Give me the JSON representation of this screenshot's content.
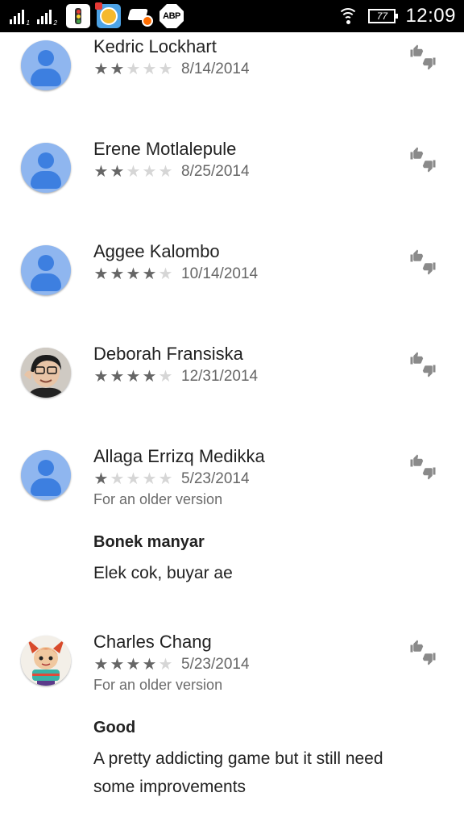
{
  "status_bar": {
    "sim1_label": "1",
    "sim2_label": "2",
    "abp_label": "ABP",
    "battery": "77",
    "time": "12:09"
  },
  "reviews": [
    {
      "name": "Kedric Lockhart",
      "rating": 2,
      "date": "8/14/2014",
      "avatar": "default"
    },
    {
      "name": "Erene Motlalepule",
      "rating": 2,
      "date": "8/25/2014",
      "avatar": "default"
    },
    {
      "name": "Aggee Kalombo",
      "rating": 4,
      "date": "10/14/2014",
      "avatar": "default"
    },
    {
      "name": "Deborah Fransiska",
      "rating": 4,
      "date": "12/31/2014",
      "avatar": "photo"
    },
    {
      "name": "Allaga Errizq Medikka",
      "rating": 1,
      "date": "5/23/2014",
      "avatar": "default",
      "version_note": "For an older version",
      "title": "Bonek manyar",
      "body": "Elek cok, buyar ae"
    },
    {
      "name": "Charles Chang",
      "rating": 4,
      "date": "5/23/2014",
      "avatar": "photo",
      "version_note": "For an older version",
      "title": "Good",
      "body": "A pretty addicting game but it still need some improvements"
    }
  ],
  "icons": {
    "thumb_up": "thumbs-up-icon",
    "thumb_down": "thumbs-down-icon",
    "star": "star-icon"
  },
  "colors": {
    "status_bar_bg": "#000000",
    "avatar_default_bg": "#8fb6ef",
    "avatar_default_fg": "#3d7fe0",
    "star_on": "#666666",
    "star_off": "#d6d6d6"
  }
}
